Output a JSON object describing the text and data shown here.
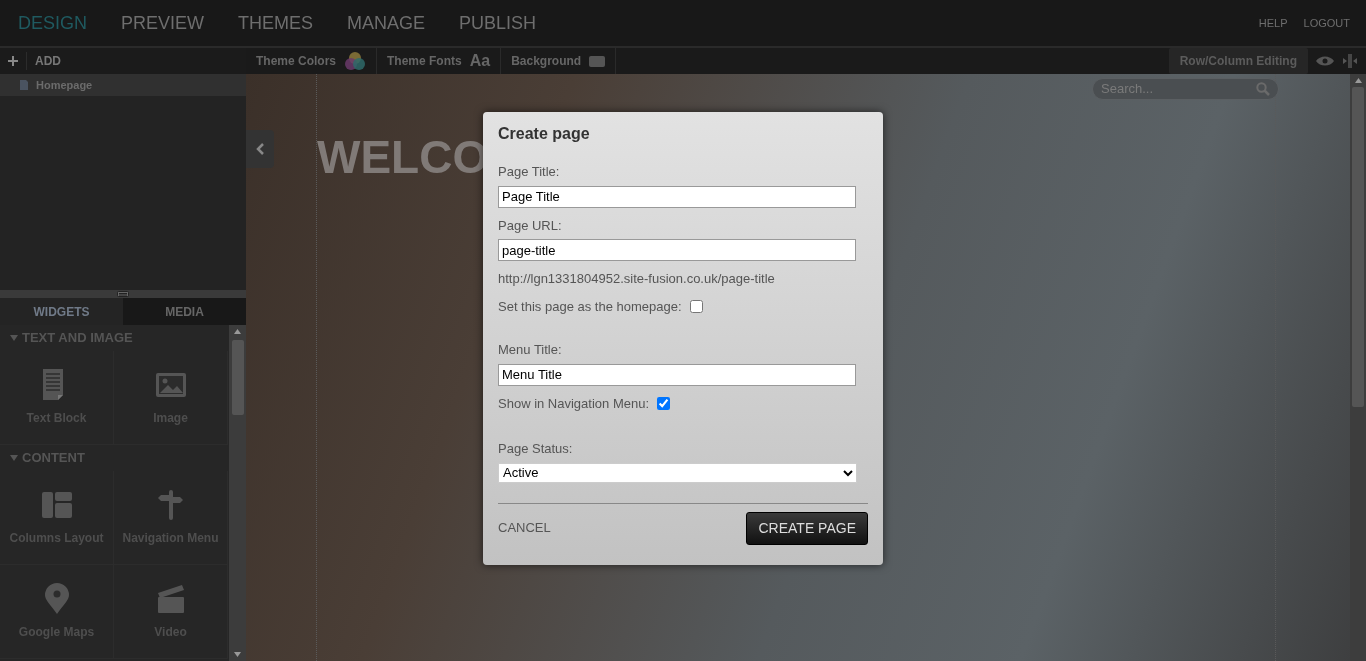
{
  "top_nav": {
    "items": [
      {
        "label": "DESIGN",
        "selected": true
      },
      {
        "label": "PREVIEW",
        "selected": false
      },
      {
        "label": "THEMES",
        "selected": false
      },
      {
        "label": "MANAGE",
        "selected": false
      },
      {
        "label": "PUBLISH",
        "selected": false
      }
    ],
    "links": [
      "HELP",
      "LOGOUT"
    ]
  },
  "sidebar": {
    "add_label": "ADD",
    "pages": [
      {
        "label": "Homepage",
        "selected": true
      }
    ],
    "tabs": [
      {
        "label": "WIDGETS",
        "selected": true
      },
      {
        "label": "MEDIA",
        "selected": false
      }
    ],
    "sections": [
      {
        "title": "TEXT AND IMAGE",
        "expanded": true,
        "widgets": [
          {
            "label": "Text Block",
            "kind": "document"
          },
          {
            "label": "Image",
            "kind": "picture"
          }
        ]
      },
      {
        "title": "CONTENT",
        "expanded": true,
        "widgets": [
          {
            "label": "Columns Layout",
            "kind": "columns"
          },
          {
            "label": "Navigation Menu",
            "kind": "signpost"
          },
          {
            "label": "Google Maps",
            "kind": "pin"
          },
          {
            "label": "Video",
            "kind": "clapper"
          }
        ]
      }
    ]
  },
  "toolbar": {
    "items": [
      {
        "label": "Theme Colors",
        "kind": "colors"
      },
      {
        "label": "Theme Fonts",
        "kind": "fonts",
        "glyph": "Aa"
      },
      {
        "label": "Background",
        "kind": "swatch"
      }
    ],
    "right_button": "Row/Column Editing"
  },
  "canvas": {
    "heading": "WELCO",
    "search": {
      "placeholder": "Search..."
    }
  },
  "dialog": {
    "title": "Create page",
    "page_title": {
      "label": "Page Title:",
      "value": "Page Title"
    },
    "page_url": {
      "label": "Page URL:",
      "value": "page-title"
    },
    "url_preview": "http://lgn1331804952.site-fusion.co.uk/page-title",
    "homepage": {
      "label": "Set this page as the homepage:",
      "checked": false
    },
    "menu_title": {
      "label": "Menu Title:",
      "value": "Menu Title"
    },
    "show_in_nav": {
      "label": "Show in Navigation Menu:",
      "checked": true
    },
    "page_status": {
      "label": "Page Status:",
      "value": "Active"
    },
    "cancel": "CANCEL",
    "submit": "CREATE PAGE"
  }
}
